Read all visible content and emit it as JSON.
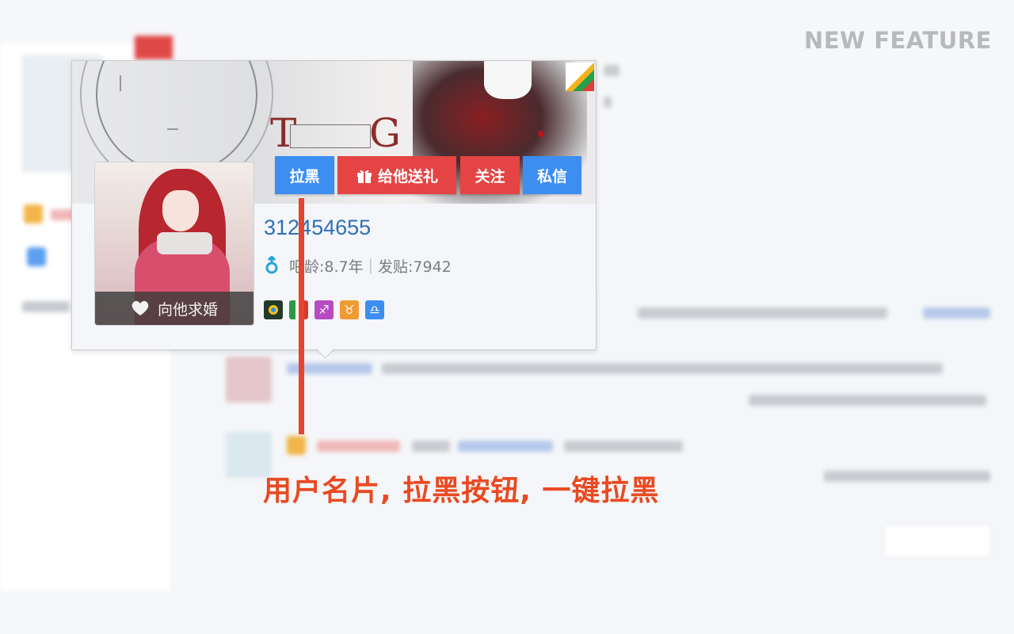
{
  "header": {
    "feature_label": "NEW FEATURE"
  },
  "user_card": {
    "username": "312454655",
    "stats": {
      "age": "吧龄:8.7年",
      "posts": "发贴:7942"
    },
    "actions": {
      "block_label": "拉黑",
      "gift_label": "给他送礼",
      "follow_label": "关注",
      "message_label": "私信"
    },
    "propose_label": "向他求婚",
    "badges": [
      "sun-badge",
      "flag-badge",
      "sagittarius-badge",
      "taurus-badge",
      "libra-badge"
    ]
  },
  "annotation": {
    "text": "用户名片, 拉黑按钮, 一键拉黑"
  },
  "colors": {
    "blue_button": "#3c8ef0",
    "red_button": "#e44444",
    "annotation": "#e94a22",
    "username": "#2f6fb8"
  }
}
